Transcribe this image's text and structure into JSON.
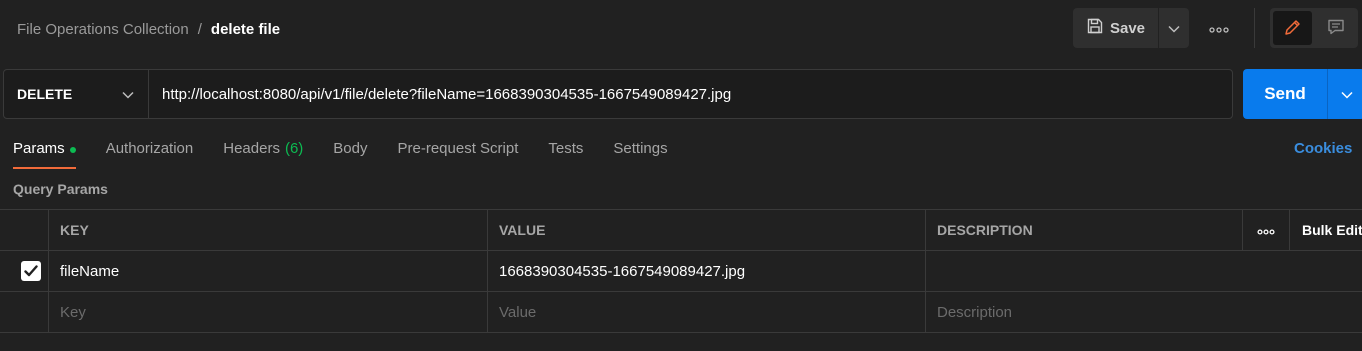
{
  "header": {
    "collection": "File Operations Collection",
    "separator": "/",
    "request_name": "delete file",
    "save_label": "Save"
  },
  "request": {
    "method": "DELETE",
    "url": "http://localhost:8080/api/v1/file/delete?fileName=1668390304535-1667549089427.jpg",
    "send_label": "Send"
  },
  "tabs": [
    {
      "label": "Params"
    },
    {
      "label": "Authorization"
    },
    {
      "label": "Headers",
      "count": "(6)"
    },
    {
      "label": "Body"
    },
    {
      "label": "Pre-request Script"
    },
    {
      "label": "Tests"
    },
    {
      "label": "Settings"
    }
  ],
  "cookies_label": "Cookies",
  "query_params": {
    "title": "Query Params",
    "columns": {
      "key": "KEY",
      "value": "VALUE",
      "description": "DESCRIPTION"
    },
    "bulk_edit_label": "Bulk Edit",
    "rows": [
      {
        "checked": true,
        "key": "fileName",
        "value": "1668390304535-1667549089427.jpg",
        "description": ""
      }
    ],
    "placeholders": {
      "key": "Key",
      "value": "Value",
      "description": "Description"
    }
  },
  "colors": {
    "background": "#212121",
    "send_button": "#097bed",
    "active_tab_underline": "#f26b3a",
    "status_dot": "#0cbb52",
    "cookies_link": "#3a8dde"
  },
  "icons": [
    "save-icon",
    "chevron-down-icon",
    "more-icon",
    "edit-icon",
    "comment-icon",
    "checkbox-checked-icon"
  ]
}
